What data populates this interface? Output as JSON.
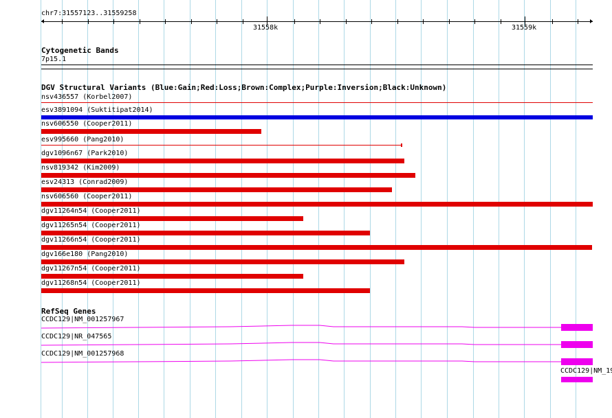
{
  "ruler": {
    "position": "chr7:31557123..31559258",
    "labels": [
      "31558k",
      "31559k"
    ]
  },
  "cyto": {
    "title": "Cytogenetic Bands",
    "band": "7p15.1"
  },
  "dgv": {
    "title": "DGV Structural Variants (Blue:Gain;Red:Loss;Brown:Complex;Purple:Inversion;Black:Unknown)",
    "items": [
      {
        "label": "nsv436557 (Korbel2007)",
        "color": "#e00000"
      },
      {
        "label": "esv3891094 (Suktitipat2014)",
        "color": "#0000e0"
      },
      {
        "label": "nsv606550 (Cooper2011)",
        "color": "#e00000"
      },
      {
        "label": "esv995660 (Pang2010)",
        "color": "#e00000"
      },
      {
        "label": "dgv1096n67 (Park2010)",
        "color": "#e00000"
      },
      {
        "label": "nsv819342 (Kim2009)",
        "color": "#e00000"
      },
      {
        "label": "esv24313 (Conrad2009)",
        "color": "#e00000"
      },
      {
        "label": "nsv606560 (Cooper2011)",
        "color": "#e00000"
      },
      {
        "label": "dgv11264n54 (Cooper2011)",
        "color": "#e00000"
      },
      {
        "label": "dgv11265n54 (Cooper2011)",
        "color": "#e00000"
      },
      {
        "label": "dgv11266n54 (Cooper2011)",
        "color": "#e00000"
      },
      {
        "label": "dgv166e180 (Pang2010)",
        "color": "#e00000"
      },
      {
        "label": "dgv11267n54 (Cooper2011)",
        "color": "#e00000"
      },
      {
        "label": "dgv11268n54 (Cooper2011)",
        "color": "#e00000"
      }
    ]
  },
  "refseq": {
    "title": "RefSeq Genes",
    "color": "#ee00ee",
    "genes": [
      {
        "label": "CCDC129|NM_001257967"
      },
      {
        "label": "CCDC129|NR_047565"
      },
      {
        "label": "CCDC129|NM_001257968"
      }
    ],
    "partial_label": "CCDC129|NM_19"
  }
}
